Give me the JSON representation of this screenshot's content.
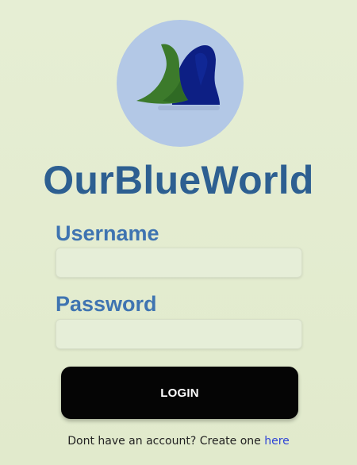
{
  "brand": {
    "name": "OurBlueWorld",
    "logo_icon": "wave-logo-icon",
    "colors": {
      "title": "#2d5f91",
      "label": "#3f74b1",
      "logo_circle": "#b3c8e6",
      "logo_green": "#3c7a2b",
      "logo_blue": "#0d1f84"
    }
  },
  "form": {
    "username_label": "Username",
    "username_value": "",
    "password_label": "Password",
    "password_value": "",
    "login_label": "LOGIN"
  },
  "footer": {
    "prompt": "Dont have an account? Create one",
    "link": "here",
    "link_color": "#2e44d6"
  }
}
